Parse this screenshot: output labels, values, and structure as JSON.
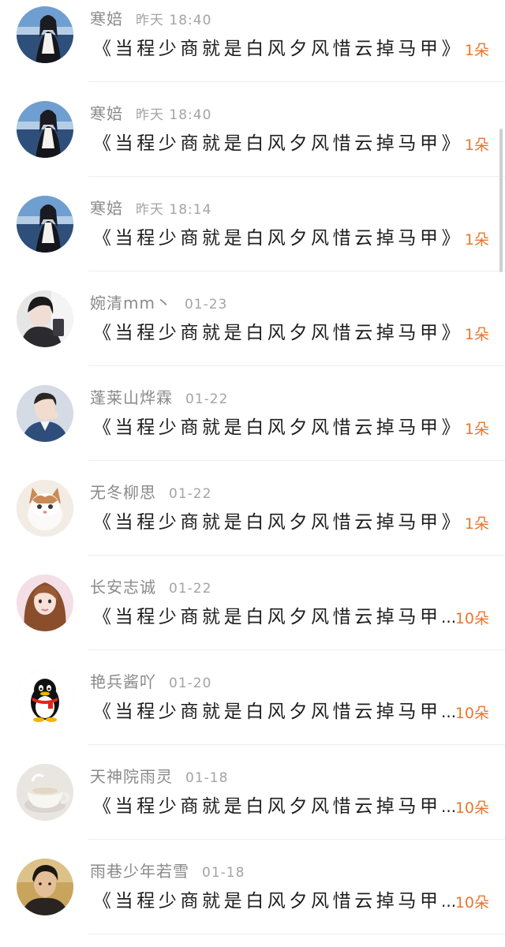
{
  "colors": {
    "flower_count": "#e8772e",
    "username": "#8a8a8a",
    "date": "#a4a4a4",
    "title": "#1e1e1e",
    "divider": "#eeeeee"
  },
  "rows": [
    {
      "username": "寒婄",
      "date": "昨天 18:40",
      "title": "《当程少商就是白风夕风惜云掉马甲》",
      "truncated": false,
      "flowers": "1朵",
      "avatar_icon": "girl-photo-avatar-icon"
    },
    {
      "username": "寒婄",
      "date": "昨天 18:40",
      "title": "《当程少商就是白风夕风惜云掉马甲》",
      "truncated": false,
      "flowers": "1朵",
      "avatar_icon": "girl-photo-avatar-icon"
    },
    {
      "username": "寒婄",
      "date": "昨天 18:14",
      "title": "《当程少商就是白风夕风惜云掉马甲》",
      "truncated": false,
      "flowers": "1朵",
      "avatar_icon": "girl-photo-avatar-icon"
    },
    {
      "username": "婉清mm丶",
      "date": "01-23",
      "title": "《当程少商就是白风夕风惜云掉马甲》",
      "truncated": false,
      "flowers": "1朵",
      "avatar_icon": "person-dark-avatar-icon"
    },
    {
      "username": "蓬莱山烨霖",
      "date": "01-22",
      "title": "《当程少商就是白风夕风惜云掉马甲》",
      "truncated": false,
      "flowers": "1朵",
      "avatar_icon": "boy-photo-avatar-icon"
    },
    {
      "username": "无冬柳思",
      "date": "01-22",
      "title": "《当程少商就是白风夕风惜云掉马甲》",
      "truncated": false,
      "flowers": "1朵",
      "avatar_icon": "cat-avatar-icon"
    },
    {
      "username": "长安志诚",
      "date": "01-22",
      "title": "《当程少商就是白风夕风惜云掉马甲",
      "truncated": true,
      "flowers": "10朵",
      "avatar_icon": "woman-pink-avatar-icon"
    },
    {
      "username": "艳兵酱吖",
      "date": "01-20",
      "title": "《当程少商就是白风夕风惜云掉马甲",
      "truncated": true,
      "flowers": "10朵",
      "avatar_icon": "qq-penguin-avatar-icon"
    },
    {
      "username": "天神院雨灵",
      "date": "01-18",
      "title": "《当程少商就是白风夕风惜云掉马甲",
      "truncated": true,
      "flowers": "10朵",
      "avatar_icon": "teacup-avatar-icon"
    },
    {
      "username": "雨巷少年若雪",
      "date": "01-18",
      "title": "《当程少商就是白风夕风惜云掉马甲",
      "truncated": true,
      "flowers": "10朵",
      "avatar_icon": "man-photo-avatar-icon"
    }
  ],
  "ellipsis": "..."
}
